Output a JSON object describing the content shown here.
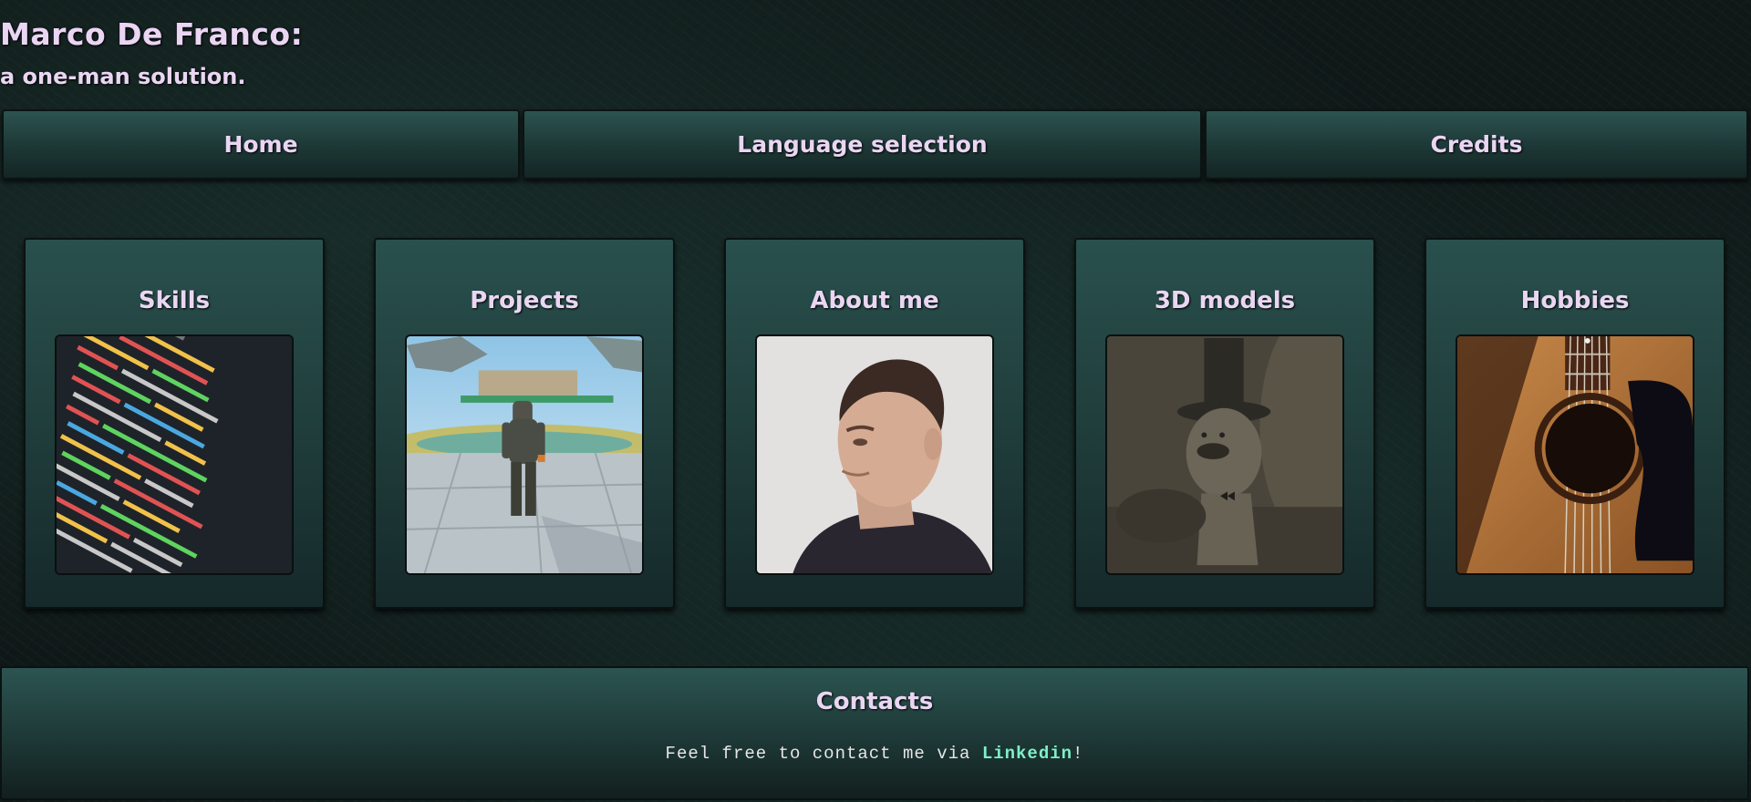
{
  "header": {
    "title": "Marco De Franco:",
    "subtitle": "a one-man solution."
  },
  "nav": {
    "home": "Home",
    "language": "Language selection",
    "credits": "Credits"
  },
  "cards": [
    {
      "label": "Skills",
      "icon": "code-screenshot"
    },
    {
      "label": "Projects",
      "icon": "game-character-screenshot"
    },
    {
      "label": "About me",
      "icon": "portrait-photo"
    },
    {
      "label": "3D models",
      "icon": "top-hat-model-render"
    },
    {
      "label": "Hobbies",
      "icon": "acoustic-guitar-photo"
    }
  ],
  "contacts": {
    "title": "Contacts",
    "text_before": "Feel free to contact me via ",
    "link": "Linkedin",
    "text_after": "!"
  },
  "colors": {
    "accent_text": "#ead6f3",
    "link": "#7ff0c9",
    "panel": "#1e3a38"
  }
}
